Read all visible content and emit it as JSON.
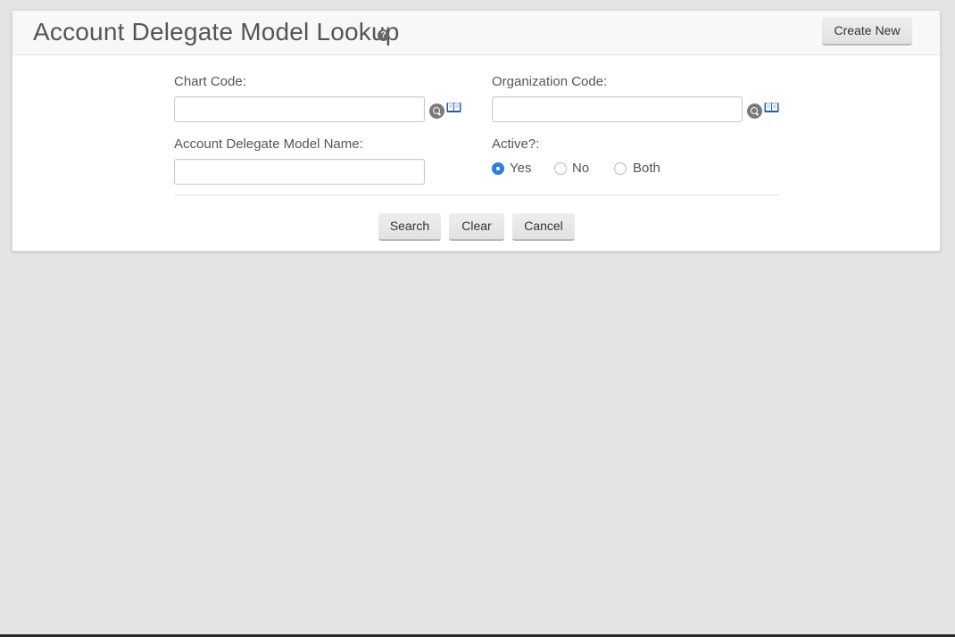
{
  "header": {
    "title": "Account Delegate Model Lookup",
    "help_glyph": "?",
    "create_new_label": "Create New"
  },
  "form": {
    "chart_code": {
      "label": "Chart Code:",
      "value": ""
    },
    "organization_code": {
      "label": "Organization Code:",
      "value": ""
    },
    "model_name": {
      "label": "Account Delegate Model Name:",
      "value": ""
    },
    "active": {
      "label": "Active?:",
      "options": [
        "Yes",
        "No",
        "Both"
      ],
      "selected": "Yes"
    }
  },
  "actions": {
    "search_label": "Search",
    "clear_label": "Clear",
    "cancel_label": "Cancel"
  },
  "icons": {
    "help": "help-icon",
    "lookup": "search-lookup-icon",
    "direct_inquiry": "book-icon"
  },
  "colors": {
    "accent": "#2e7de1",
    "background": "#e4e4e4"
  }
}
